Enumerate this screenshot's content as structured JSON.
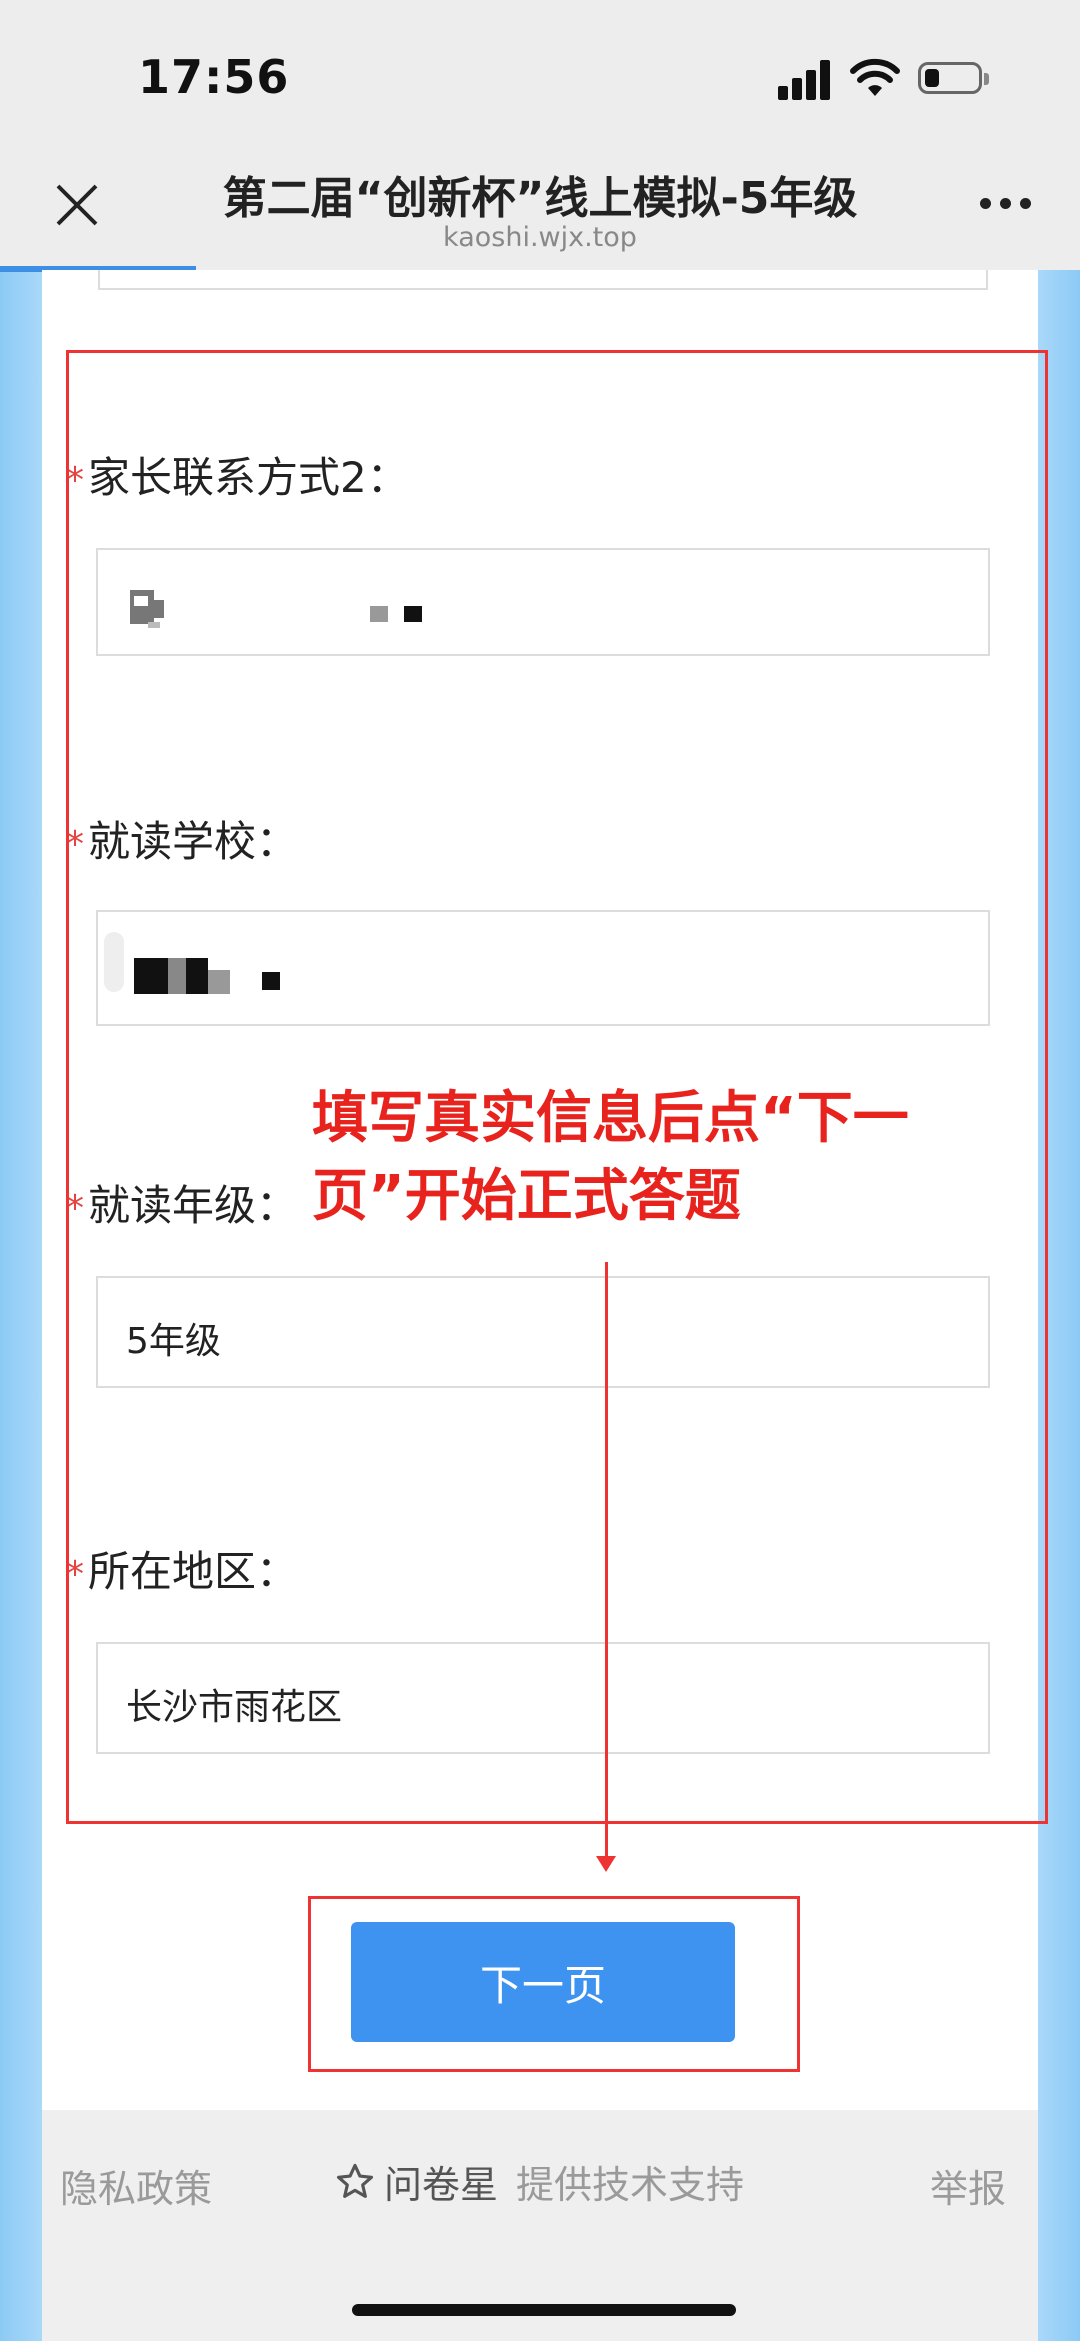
{
  "status_bar": {
    "time": "17:56"
  },
  "nav": {
    "title": "第二届“创新杯”线上模拟-5年级",
    "domain": "kaoshi.wjx.top",
    "close_icon": "close-icon",
    "more_icon": "more-icon"
  },
  "questions": [
    {
      "label": "家长联系方式2：",
      "required": "*",
      "value": ""
    },
    {
      "label": "就读学校：",
      "required": "*",
      "value": ""
    },
    {
      "label": "就读年级：",
      "required": "*",
      "value": "5年级"
    },
    {
      "label": "所在地区：",
      "required": "*",
      "value": "长沙市雨花区"
    }
  ],
  "annotation": {
    "text_line1": "填写真实信息后点“下一",
    "text_line2": "页”开始正式答题"
  },
  "next_button": {
    "label": "下一页"
  },
  "footer": {
    "privacy": "隐私政策",
    "brand": "问卷星",
    "support": "提供技术支持",
    "report": "举报"
  },
  "colors": {
    "accent": "#3f93f0",
    "annotation_red": "#e8231e",
    "required_star": "#e64340"
  }
}
